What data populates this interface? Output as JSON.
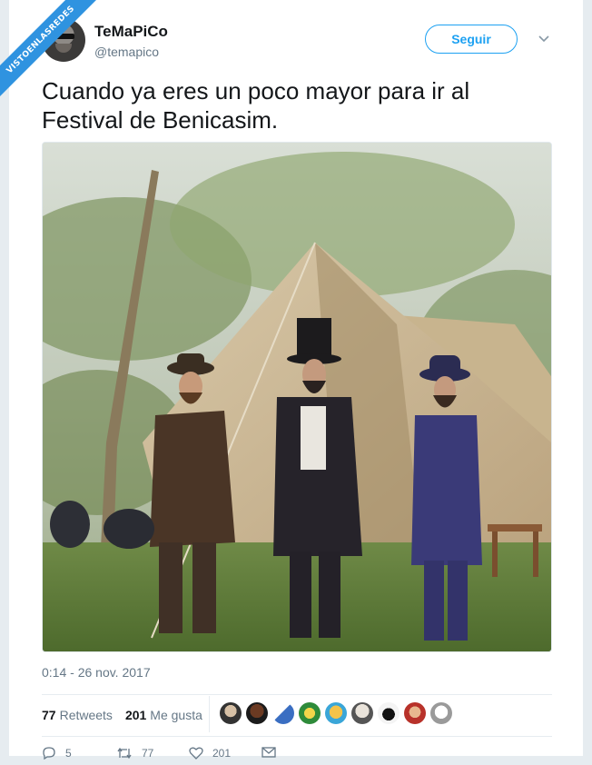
{
  "watermark": {
    "text": "VISTOENLASREDES"
  },
  "tweet": {
    "author_name": "TeMaPiCo",
    "author_handle": "@temapico",
    "follow_label": "Seguir",
    "text": "Cuando ya eres un poco mayor para ir al Festival de Benicasim.",
    "timestamp": "0:14 - 26 nov. 2017"
  },
  "stats": {
    "retweets_count": "77",
    "retweets_label": "Retweets",
    "likes_count": "201",
    "likes_label": "Me gusta"
  },
  "actions": {
    "reply_count": "5",
    "retweet_count": "77",
    "like_count": "201"
  },
  "colors": {
    "accent": "#1da1f2",
    "ribbon": "#2f93e0",
    "secondary_text": "#657786"
  },
  "icons": [
    "chevron-down-icon",
    "reply-icon",
    "retweet-icon",
    "heart-icon",
    "message-icon"
  ]
}
